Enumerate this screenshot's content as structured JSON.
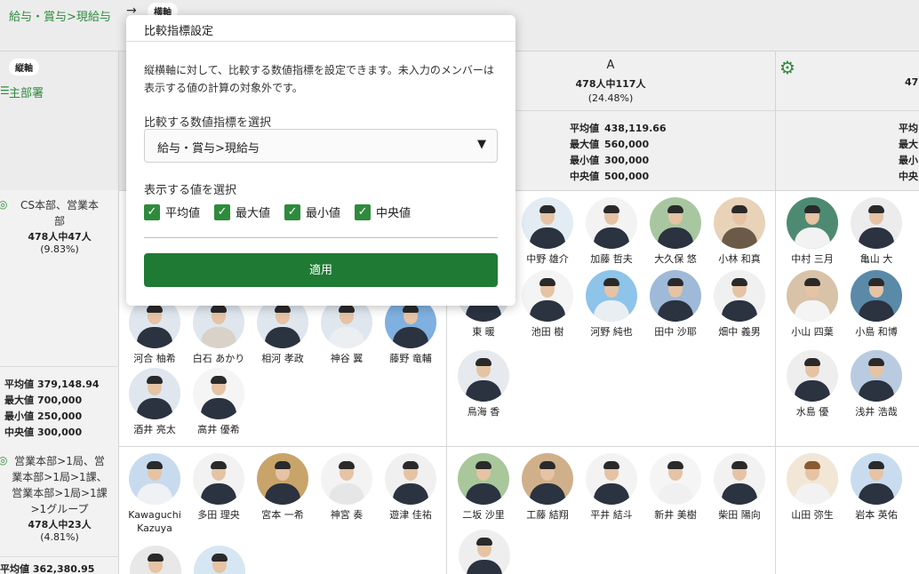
{
  "header": {
    "breadcrumb": "給与・賞与>現給与",
    "arrow": "→",
    "yoko_label": "横軸"
  },
  "axis": {
    "tate_label": "縦軸",
    "tate_value": "主部署",
    "tate_icon": "list-icon"
  },
  "columnA": {
    "title": "A",
    "count": "478人中117人",
    "pct": "(24.48%)",
    "stats": [
      {
        "label": "平均値",
        "value": "438,119.66"
      },
      {
        "label": "最大値",
        "value": "560,000"
      },
      {
        "label": "最小値",
        "value": "300,000"
      },
      {
        "label": "中央値",
        "value": "500,000"
      }
    ]
  },
  "columnB": {
    "count_cut": "47",
    "stat_cut": [
      "平均",
      "最大",
      "最小",
      "中央"
    ],
    "icon": "gear-icon"
  },
  "dialog": {
    "title": "比較指標設定",
    "description": "縦横軸に対して、比較する数値指標を設定できます。未入力のメンバーは表示する値の計算の対象外です。",
    "select_label": "比較する数値指標を選択",
    "select_value": "給与・賞与>現給与",
    "values_label": "表示する値を選択",
    "checkboxes": [
      {
        "label": "平均値",
        "checked": true
      },
      {
        "label": "最大値",
        "checked": true
      },
      {
        "label": "最小値",
        "checked": true
      },
      {
        "label": "中央値",
        "checked": true
      }
    ],
    "apply_label": "適用"
  },
  "row1": {
    "dept_name": [
      "CS本部、営業本",
      "部"
    ],
    "count": "478人中47人",
    "pct": "(9.83%)",
    "stats": [
      {
        "label": "平均値",
        "value": "379,148.94"
      },
      {
        "label": "最大値",
        "value": "700,000"
      },
      {
        "label": "最小値",
        "value": "250,000"
      },
      {
        "label": "中央値",
        "value": "300,000"
      }
    ],
    "left_people_top": [
      "河合 柚希",
      "白石 あかり",
      "相河 孝政",
      "神谷 翼",
      "藤野 竜輔"
    ],
    "left_people_bottom": [
      "酒井 亮太",
      "高井 優希"
    ],
    "colA_people_1": [
      "中野 雄介",
      "加藤 哲夫",
      "大久保 悠",
      "小林 和真"
    ],
    "colA_people_2": [
      "東 暖",
      "池田 樹",
      "河野 純也",
      "田中 沙耶",
      "畑中 義男"
    ],
    "colA_people_3": [
      "鳥海 香"
    ],
    "colB_people_1": [
      "中村 三月",
      "亀山 大"
    ],
    "colB_people_2": [
      "小山 四葉",
      "小島 和博"
    ],
    "colB_people_3": [
      "水島 優",
      "浅井 浩哉"
    ]
  },
  "row2": {
    "dept_name": [
      "営業本部>1局、営",
      "業本部>1局>1課、",
      "営業本部>1局>1課",
      ">1グループ"
    ],
    "count": "478人中23人",
    "pct": "(4.81%)",
    "stat_cut": "平均値 362,380.95",
    "left_people": [
      "Kawaguchi Kazuya",
      "多田 理央",
      "宮本 一希",
      "神宮 奏",
      "遊津 佳祐"
    ],
    "colA_people": [
      "二坂 沙里",
      "工藤 結翔",
      "平井 結斗",
      "新井 美樹",
      "柴田 陽向"
    ],
    "colB_people": [
      "山田 弥生",
      "岩本 英佑"
    ]
  },
  "colors": {
    "accent": "#2e8b3c",
    "apply": "#1f7a34"
  }
}
